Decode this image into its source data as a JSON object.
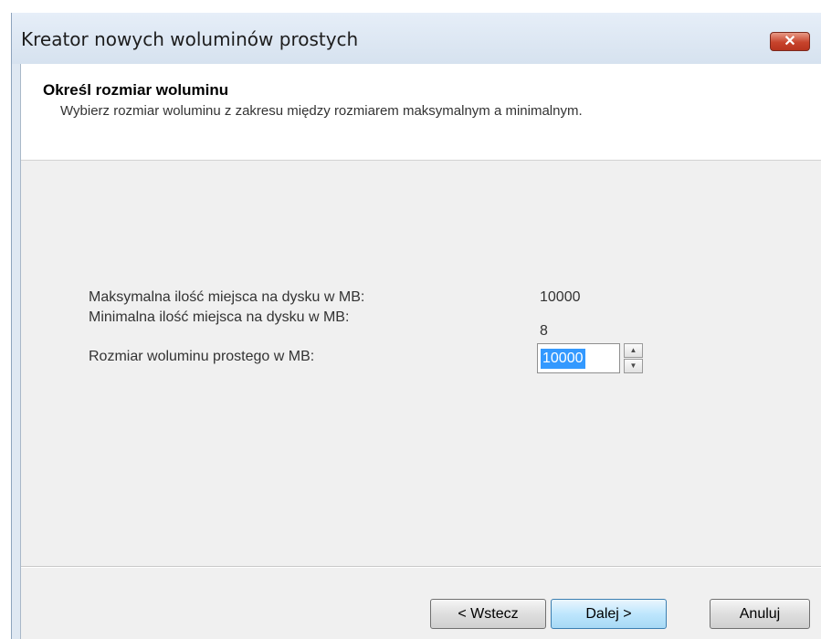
{
  "window": {
    "title": "Kreator nowych woluminów prostych",
    "close_symbol": "✕"
  },
  "header": {
    "title": "Określ rozmiar woluminu",
    "description": "Wybierz rozmiar woluminu z zakresu między rozmiarem maksymalnym a minimalnym."
  },
  "fields": {
    "max_label": "Maksymalna ilość miejsca na dysku w MB:",
    "max_value": "10000",
    "min_label": "Minimalna ilość miejsca na dysku w MB:",
    "min_value": "8",
    "size_label": "Rozmiar woluminu prostego w MB:",
    "size_value": "10000"
  },
  "buttons": {
    "back": "< Wstecz",
    "next": "Dalej >",
    "cancel": "Anuluj"
  },
  "icons": {
    "spin_up": "spin-up-arrow",
    "spin_down": "spin-down-arrow",
    "close": "close-icon"
  },
  "colors": {
    "selection": "#3399ff",
    "close_button": "#c7432c",
    "default_button": "#bee6fd"
  }
}
